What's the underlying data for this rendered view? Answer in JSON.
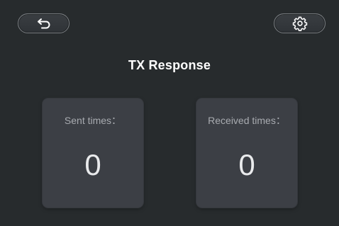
{
  "header": {
    "title": "TX Response",
    "back_icon": "back-arrow-icon",
    "settings_icon": "gear-icon"
  },
  "stats": {
    "sent": {
      "label": "Sent times：",
      "value": "0"
    },
    "received": {
      "label": "Received times：",
      "value": "0"
    }
  },
  "colors": {
    "background": "#272b2d",
    "card": "#3c3f45",
    "title": "#ffffff",
    "label": "#a8abb0",
    "value": "#e9eaec"
  }
}
